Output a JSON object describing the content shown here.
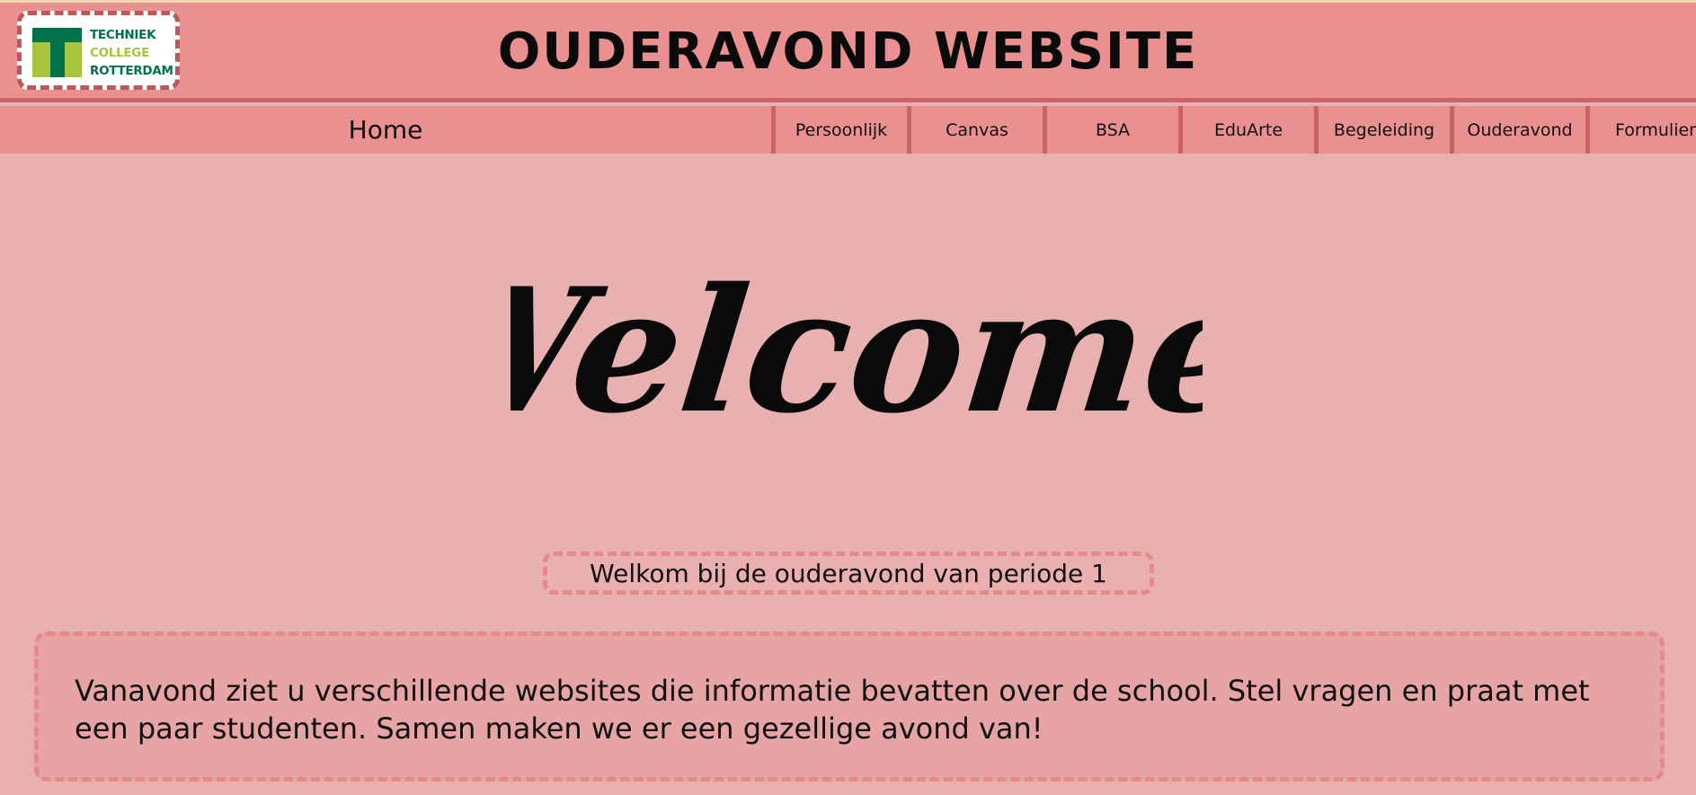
{
  "header": {
    "logo": {
      "line1": "TECHNIEK",
      "line2": "COLLEGE",
      "line3": "ROTTERDAM"
    },
    "title": "Ouderavond Website"
  },
  "nav": {
    "home": "Home",
    "items": [
      "Persoonlijk",
      "Canvas",
      "BSA",
      "EduArte",
      "Begeleiding",
      "Ouderavond",
      "Formulier"
    ]
  },
  "main": {
    "welcome": "Welcome!",
    "subtitle": "Welkom bij de ouderavond van periode 1",
    "intro": "Vanavond ziet u verschillende websites die informatie bevatten over de school. Stel vragen en praat met een paar studenten. Samen maken we er een gezellige avond van!"
  },
  "colors": {
    "header_bg": "#ea9090",
    "page_bg": "#e9b0b0",
    "accent_border": "#c86464",
    "dashed_border": "#e58a8a",
    "logo_green": "#007249",
    "logo_lime": "#a8c43a"
  }
}
